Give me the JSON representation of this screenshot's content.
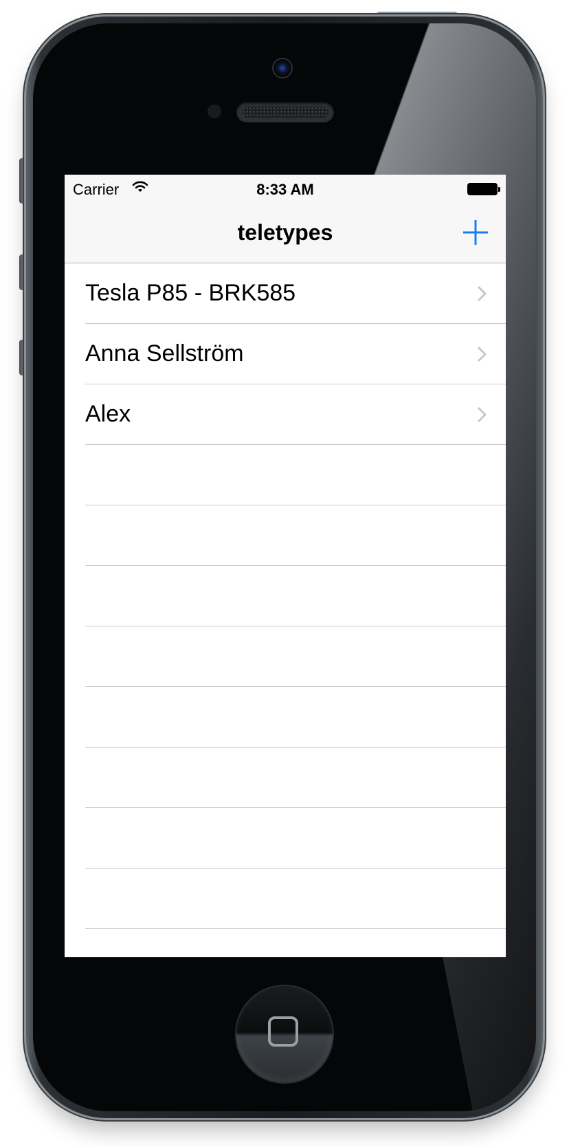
{
  "status_bar": {
    "carrier": "Carrier",
    "time": "8:33 AM",
    "wifi_icon": "wifi-icon",
    "battery_icon": "battery-icon"
  },
  "nav_bar": {
    "title": "teletypes",
    "add_icon": "plus-icon",
    "accent_color": "#1a7cf5"
  },
  "table": {
    "rows": [
      {
        "label": "Tesla P85 - BRK585",
        "accessory": "chevron-right-icon"
      },
      {
        "label": "Anna Sellström",
        "accessory": "chevron-right-icon"
      },
      {
        "label": "Alex",
        "accessory": "chevron-right-icon"
      }
    ],
    "empty_rows": 8
  },
  "device": {
    "home_button_icon": "home-square-icon"
  }
}
